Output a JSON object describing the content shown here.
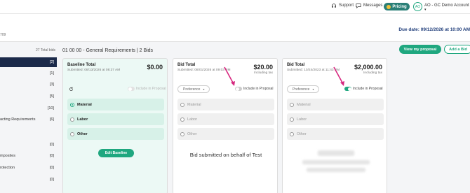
{
  "nav": {
    "support": "Support",
    "messages": "Messages",
    "pricing": "Pricing",
    "avatar_initials": "AO",
    "account": "AO - GC Demo Account"
  },
  "header": {
    "project_number": "709",
    "due_date": "Due date: 09/12/2026 at 10:00 AM"
  },
  "sidebar": {
    "total_bids": "27 Total bids",
    "items": [
      {
        "label": "",
        "count": "[2]",
        "active": true
      },
      {
        "label": "",
        "count": "[1]"
      },
      {
        "label": "",
        "count": "[3]"
      },
      {
        "label": "",
        "count": "[5]"
      },
      {
        "label": "",
        "count": "[10]"
      },
      {
        "label": "acting Requirements",
        "count": "[6]"
      },
      {
        "label": "",
        "count": "[0]"
      },
      {
        "label": "mposites",
        "count": "[0]"
      },
      {
        "label": "rotection",
        "count": "[0]"
      },
      {
        "label": "",
        "count": "[0]"
      }
    ]
  },
  "section": {
    "title": "01 00 00 - General Requirements | 2 Bids"
  },
  "actions": {
    "view_proposal": "View my proposal",
    "add_bid": "Add a Bid"
  },
  "cards": [
    {
      "title": "Baseline Total",
      "submitted": "Submitted: 08/13/2026 at 08:37 AM",
      "amount": "$0.00",
      "include_label": "Include in Proposal",
      "options": [
        "Material",
        "Labor",
        "Other"
      ],
      "edit_label": "Edit Baseline"
    },
    {
      "title": "Bid Total",
      "submitted": "Submitted: 08/01/2026 at 09:03 PM",
      "amount": "$20.00",
      "tax": "Including tax",
      "preference": "Preference",
      "include_label": "Include in Proposal",
      "include_on": false,
      "options": [
        "Material",
        "Labor",
        "Other"
      ],
      "behalf": "Bid submitted on behalf of Test"
    },
    {
      "title": "Bid Total",
      "submitted": "Submitted: 10/24/2023 at 11:43 PM",
      "amount": "$2,000.00",
      "tax": "Including tax",
      "preference": "Preference",
      "include_label": "Include in Proposal",
      "include_on": true,
      "options": [
        "Material",
        "Labor",
        "Other"
      ]
    }
  ],
  "colors": {
    "accent": "#1fa77f",
    "pricing": "#2a7f77",
    "sidebar_active": "#1b2a4a",
    "arrow": "#d6287f"
  },
  "icons": [
    "headset-icon",
    "message-icon",
    "refresh-icon",
    "arrow-annotation"
  ]
}
